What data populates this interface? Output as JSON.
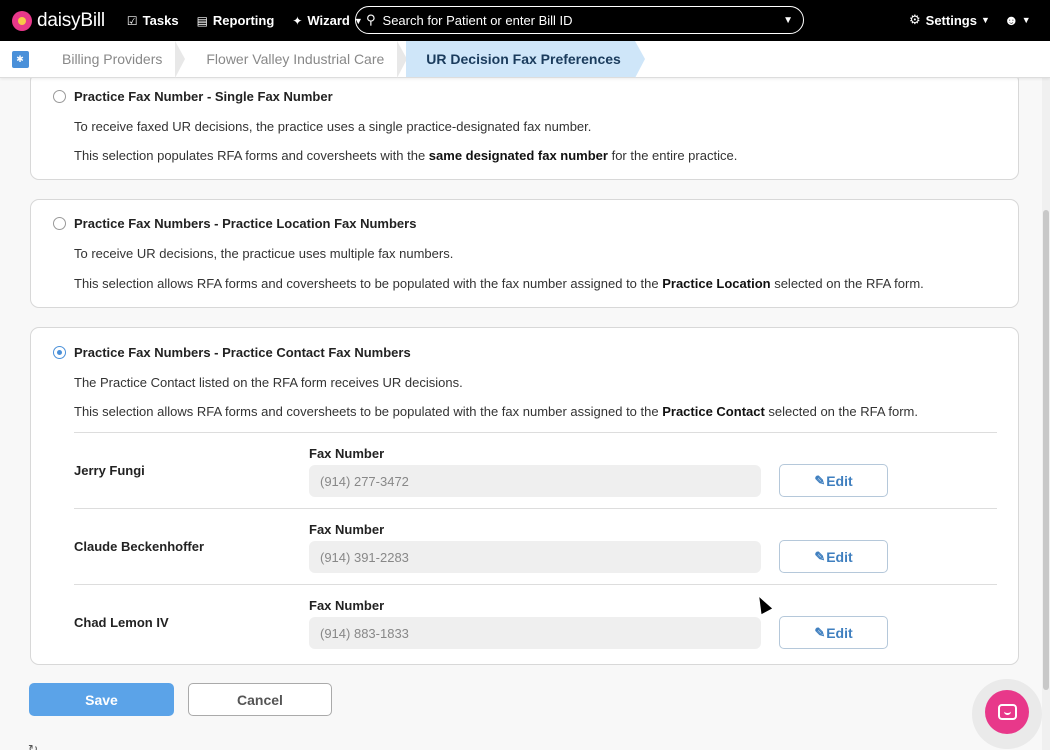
{
  "nav": {
    "brand": "daisyBill",
    "tasks": "Tasks",
    "reporting": "Reporting",
    "wizard": "Wizard",
    "search_placeholder": "Search for Patient or enter Bill ID",
    "settings": "Settings"
  },
  "breadcrumb": {
    "items": [
      "Billing Providers",
      "Flower Valley Industrial Care",
      "UR Decision Fax Preferences"
    ]
  },
  "options": [
    {
      "title": "Practice Fax Number - Single Fax Number",
      "desc1": "To receive faxed UR decisions, the practice uses a single practice-designated fax number.",
      "desc2_pre": "This selection populates RFA forms and coversheets with the ",
      "desc2_bold": "same designated fax number",
      "desc2_post": " for the entire practice.",
      "selected": false
    },
    {
      "title": "Practice Fax Numbers - Practice Location Fax Numbers",
      "desc1": "To receive UR decisions, the practicue uses multiple fax numbers.",
      "desc2_pre": "This selection allows RFA forms and coversheets to be populated with the fax number assigned to the ",
      "desc2_bold": "Practice Location",
      "desc2_post": " selected on the RFA form.",
      "selected": false
    },
    {
      "title": "Practice Fax Numbers - Practice Contact Fax Numbers",
      "desc1": "The Practice Contact listed on the RFA form receives UR decisions.",
      "desc2_pre": "This selection allows RFA forms and coversheets to be populated with the fax number assigned to the ",
      "desc2_bold": "Practice Contact",
      "desc2_post": " selected on the RFA form.",
      "selected": true
    }
  ],
  "contacts": {
    "fax_label": "Fax Number",
    "edit_label": "Edit",
    "rows": [
      {
        "name": "Jerry Fungi",
        "fax": "(914) 277-3472"
      },
      {
        "name": "Claude Beckenhoffer",
        "fax": "(914) 391-2283"
      },
      {
        "name": "Chad Lemon IV",
        "fax": "(914) 883-1833"
      }
    ]
  },
  "actions": {
    "save": "Save",
    "cancel": "Cancel"
  },
  "colors": {
    "accent": "#4a90d9",
    "brand": "#e8388a",
    "active_crumb": "#cfe6f9"
  }
}
